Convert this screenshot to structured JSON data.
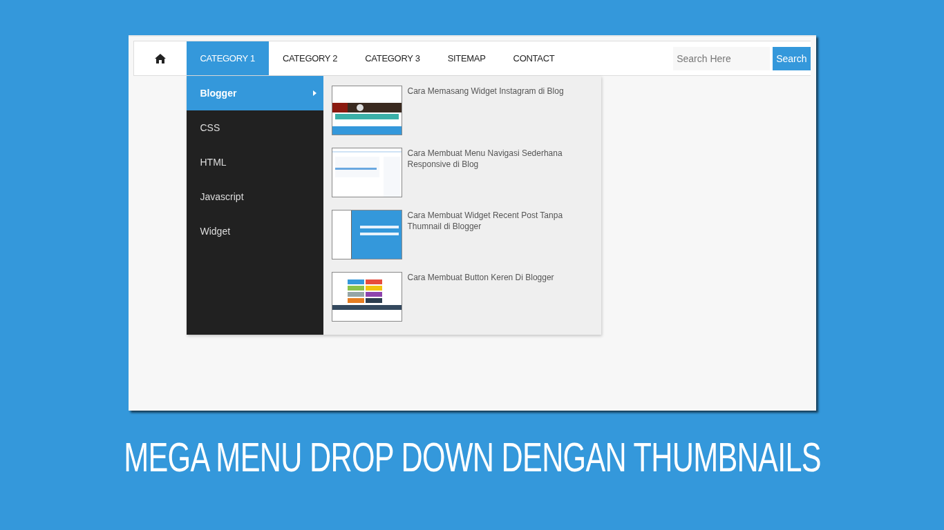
{
  "nav": {
    "items": [
      {
        "label": "CATEGORY 1",
        "selected": true
      },
      {
        "label": "CATEGORY 2",
        "selected": false
      },
      {
        "label": "CATEGORY 3",
        "selected": false
      },
      {
        "label": "SITEMAP",
        "selected": false
      },
      {
        "label": "CONTACT",
        "selected": false
      }
    ]
  },
  "search": {
    "placeholder": "Search Here",
    "button": "Search"
  },
  "submenu": [
    {
      "label": "Blogger",
      "selected": true
    },
    {
      "label": "CSS",
      "selected": false
    },
    {
      "label": "HTML",
      "selected": false
    },
    {
      "label": "Javascript",
      "selected": false
    },
    {
      "label": "Widget",
      "selected": false
    }
  ],
  "posts": [
    {
      "title": "Cara Memasang Widget Instagram di Blog"
    },
    {
      "title": "Cara Membuat Menu Navigasi Sederhana Responsive di Blog"
    },
    {
      "title": "Cara Membuat Widget Recent Post Tanpa Thumnail di Blogger"
    },
    {
      "title": "Cara Membuat Button Keren Di Blogger"
    }
  ],
  "caption": "MEGA MENU DROP DOWN DENGAN THUMBNAILS"
}
